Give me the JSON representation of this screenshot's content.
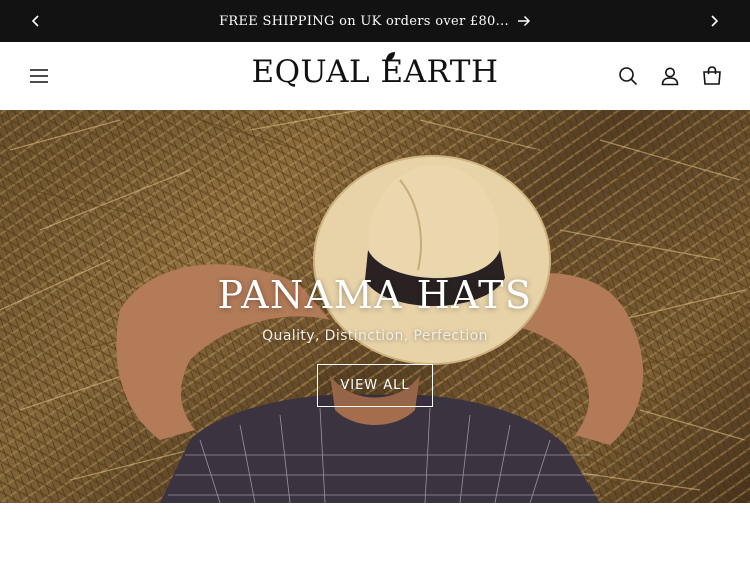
{
  "announcement": {
    "text": "FREE SHIPPING on UK orders over £80...",
    "prev_icon": "chevron-left-icon",
    "next_icon": "chevron-right-icon",
    "link_icon": "arrow-right-icon"
  },
  "header": {
    "logo": "EQUAL EARTH",
    "menu_icon": "hamburger-menu-icon",
    "actions": [
      "search-icon",
      "account-icon",
      "cart-icon"
    ]
  },
  "hero": {
    "title": "PANAMA HATS",
    "subtitle": "Quality, Distinction, Perfection",
    "cta_label": "VIEW ALL"
  },
  "colors": {
    "bar_bg": "#121212",
    "text": "#121212",
    "hero_text": "#ffffff"
  }
}
